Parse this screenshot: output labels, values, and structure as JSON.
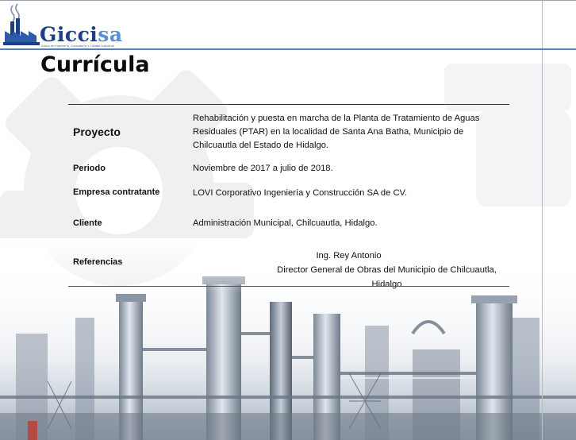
{
  "brand": {
    "name_main": "Gicci",
    "name_accent": "sa",
    "tagline": "Grupo de Ingeniería, Consultoría y Calidad Industrial"
  },
  "title": "Currícula",
  "rows": {
    "proyecto": {
      "label": "Proyecto",
      "value_line1": "Rehabilitación y puesta en marcha de la Planta de Tratamiento de Aguas",
      "value_line2": "Residuales (PTAR) en la localidad de Santa Ana Batha, Municipio de",
      "value_line3": "Chilcuautla del Estado de Hidalgo."
    },
    "periodo": {
      "label": "Periodo",
      "value": "Noviembre de 2017 a julio de 2018."
    },
    "empresa": {
      "label": "Empresa contratante",
      "value": "LOVI Corporativo Ingeniería y Construcción SA de CV."
    },
    "cliente": {
      "label": "Cliente",
      "value": "Administración Municipal, Chilcuautla, Hidalgo."
    },
    "referencias": {
      "label": "Referencias",
      "name": "Ing. Rey Antonio",
      "position": "Director General de Obras del Municipio de Chilcuautla, Hidalgo"
    }
  },
  "colors": {
    "brand_dark": "#1d3f86",
    "brand_light": "#5b8fd6",
    "header_rule": "#5a7fb8"
  }
}
